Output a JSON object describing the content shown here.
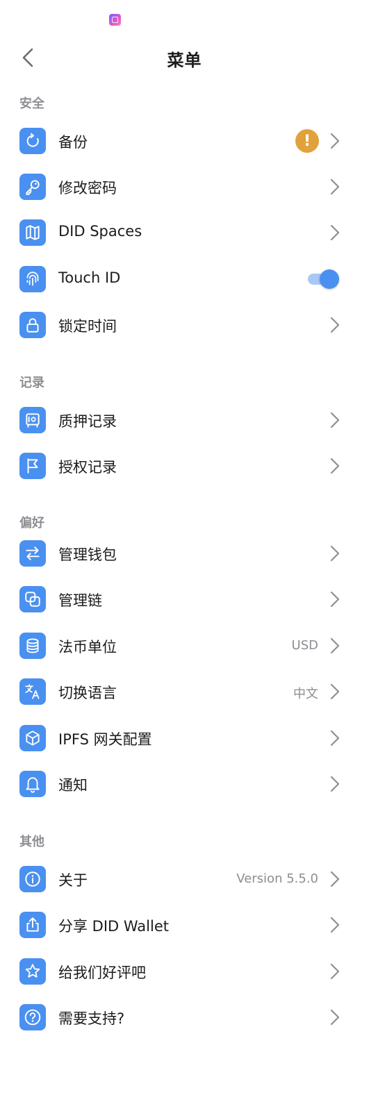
{
  "header": {
    "title": "菜单"
  },
  "sections": {
    "security": {
      "title": "安全"
    },
    "records": {
      "title": "记录"
    },
    "preferences": {
      "title": "偏好"
    },
    "other": {
      "title": "其他"
    }
  },
  "rows": {
    "backup": {
      "label": "备份",
      "icon": "refresh-icon",
      "badge": "!"
    },
    "change_password": {
      "label": "修改密码",
      "icon": "key-icon"
    },
    "did_spaces": {
      "label": "DID Spaces",
      "icon": "map-icon"
    },
    "touch_id": {
      "label": "Touch ID",
      "icon": "fingerprint-icon",
      "enabled": true
    },
    "lock_time": {
      "label": "锁定时间",
      "icon": "lock-icon"
    },
    "staking_records": {
      "label": "质押记录",
      "icon": "safe-icon"
    },
    "authorization_records": {
      "label": "授权记录",
      "icon": "flag-icon"
    },
    "manage_wallet": {
      "label": "管理钱包",
      "icon": "swap-arrows-icon"
    },
    "manage_chain": {
      "label": "管理链",
      "icon": "link-icon"
    },
    "fiat_unit": {
      "label": "法币单位",
      "icon": "database-icon",
      "value": "USD"
    },
    "language": {
      "label": "切换语言",
      "icon": "translate-icon",
      "value": "中文"
    },
    "ipfs_gateway": {
      "label": "IPFS 网关配置",
      "icon": "cube-icon"
    },
    "notifications": {
      "label": "通知",
      "icon": "bell-icon"
    },
    "about": {
      "label": "关于",
      "icon": "info-icon",
      "value": "Version 5.5.0"
    },
    "share": {
      "label": "分享 DID Wallet",
      "icon": "share-icon"
    },
    "rate": {
      "label": "给我们好评吧",
      "icon": "star-icon"
    },
    "support": {
      "label": "需要支持?",
      "icon": "help-icon"
    }
  },
  "colors": {
    "accent": "#4a90f0",
    "warning": "#e2a23b",
    "section_title": "#8e8e93",
    "value_text": "#8e8e93"
  }
}
